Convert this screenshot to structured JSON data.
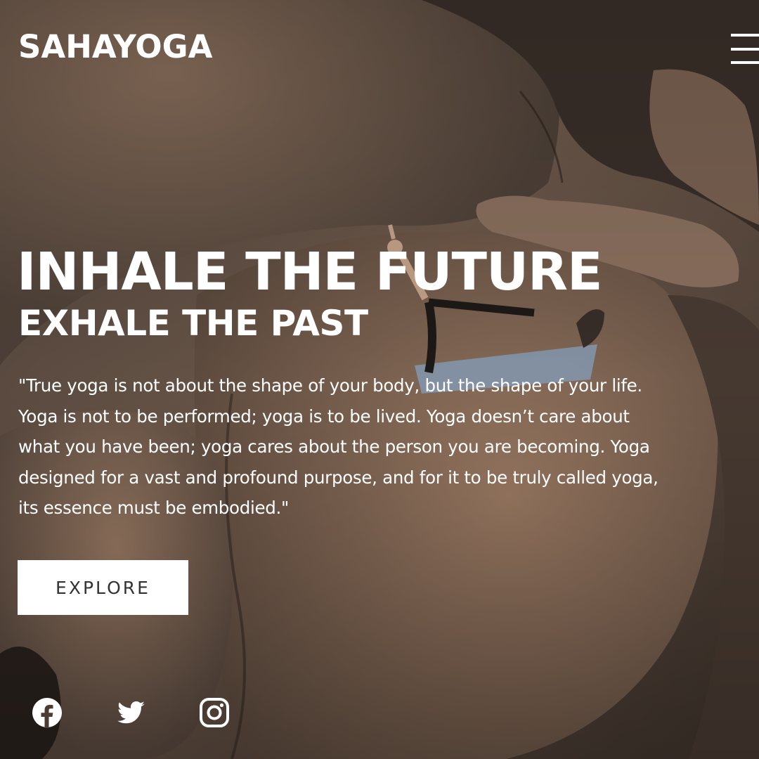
{
  "header": {
    "brand": "SAHAYOGA",
    "menu_icon": "hamburger-menu-icon"
  },
  "hero": {
    "headline": "INHALE THE FUTURE",
    "subheadline": "EXHALE THE PAST",
    "quote_lines": [
      "\"True yoga is not about the shape of your body, but the shape of your life.",
      "Yoga is not to be performed; yoga is to be lived. Yoga doesn’t care about",
      "what you have been; yoga cares about the person you are becoming. Yoga",
      "designed for a vast and profound purpose, and for it to be truly called yoga,",
      "its essence must be embodied.\""
    ],
    "cta_label": "EXPLORE",
    "background": "aerial photo of a person doing a yoga pose on a mat atop large rocks"
  },
  "social": [
    {
      "name": "facebook-icon"
    },
    {
      "name": "twitter-icon"
    },
    {
      "name": "instagram-icon"
    }
  ],
  "colors": {
    "text": "#ffffff",
    "button_bg": "#ffffff",
    "button_text": "#333333"
  }
}
